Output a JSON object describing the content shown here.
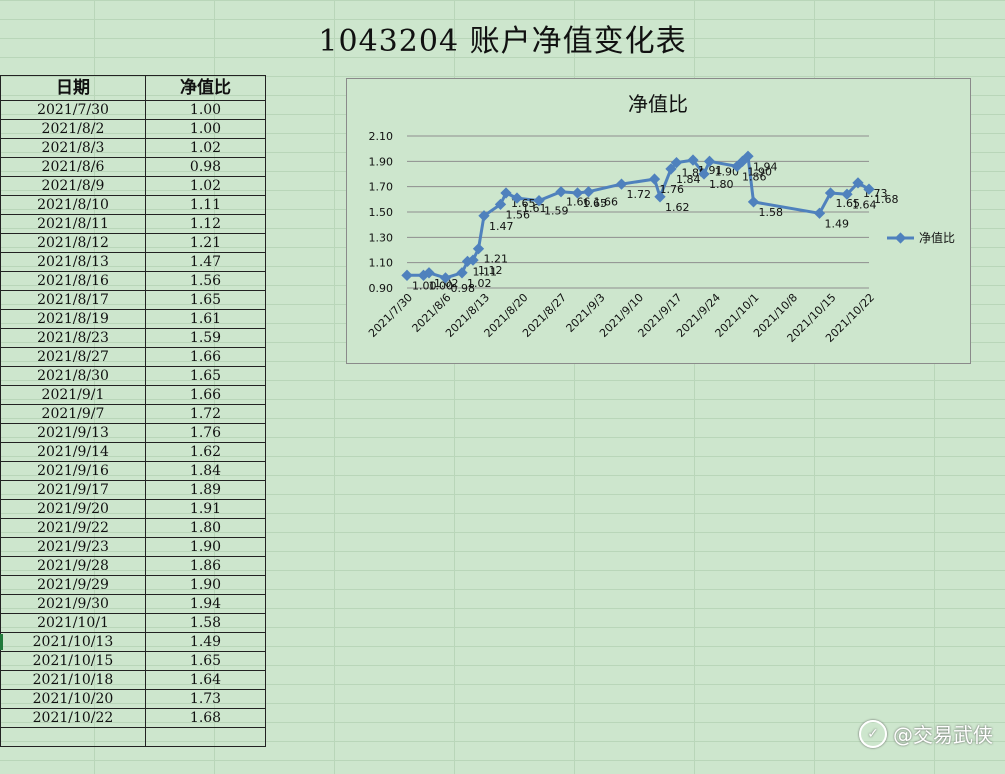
{
  "sheet": {
    "title": "1043204 账户净值变化表",
    "headers": [
      "日期",
      "净值比"
    ],
    "rows": [
      [
        "2021/7/30",
        "1.00"
      ],
      [
        "2021/8/2",
        "1.00"
      ],
      [
        "2021/8/3",
        "1.02"
      ],
      [
        "2021/8/6",
        "0.98"
      ],
      [
        "2021/8/9",
        "1.02"
      ],
      [
        "2021/8/10",
        "1.11"
      ],
      [
        "2021/8/11",
        "1.12"
      ],
      [
        "2021/8/12",
        "1.21"
      ],
      [
        "2021/8/13",
        "1.47"
      ],
      [
        "2021/8/16",
        "1.56"
      ],
      [
        "2021/8/17",
        "1.65"
      ],
      [
        "2021/8/19",
        "1.61"
      ],
      [
        "2021/8/23",
        "1.59"
      ],
      [
        "2021/8/27",
        "1.66"
      ],
      [
        "2021/8/30",
        "1.65"
      ],
      [
        "2021/9/1",
        "1.66"
      ],
      [
        "2021/9/7",
        "1.72"
      ],
      [
        "2021/9/13",
        "1.76"
      ],
      [
        "2021/9/14",
        "1.62"
      ],
      [
        "2021/9/16",
        "1.84"
      ],
      [
        "2021/9/17",
        "1.89"
      ],
      [
        "2021/9/20",
        "1.91"
      ],
      [
        "2021/9/22",
        "1.80"
      ],
      [
        "2021/9/23",
        "1.90"
      ],
      [
        "2021/9/28",
        "1.86"
      ],
      [
        "2021/9/29",
        "1.90"
      ],
      [
        "2021/9/30",
        "1.94"
      ],
      [
        "2021/10/1",
        "1.58"
      ],
      [
        "2021/10/13",
        "1.49"
      ],
      [
        "2021/10/15",
        "1.65"
      ],
      [
        "2021/10/18",
        "1.64"
      ],
      [
        "2021/10/20",
        "1.73"
      ],
      [
        "2021/10/22",
        "1.68"
      ],
      [
        "",
        ""
      ]
    ]
  },
  "chart_data": {
    "type": "line",
    "title": "净值比",
    "legend": "净值比",
    "legend_position": "right",
    "xlabel": "",
    "ylabel": "",
    "ylim": [
      0.9,
      2.1
    ],
    "yticks": [
      "2.10",
      "1.90",
      "1.70",
      "1.50",
      "1.30",
      "1.10",
      "0.90"
    ],
    "xticks": [
      "2021/7/30",
      "2021/8/6",
      "2021/8/13",
      "2021/8/20",
      "2021/8/27",
      "2021/9/3",
      "2021/9/10",
      "2021/9/17",
      "2021/9/24",
      "2021/10/1",
      "2021/10/8",
      "2021/10/15",
      "2021/10/22"
    ],
    "grid": true,
    "series_color": "#4f81bd",
    "x": [
      "2021/7/30",
      "2021/8/2",
      "2021/8/3",
      "2021/8/6",
      "2021/8/9",
      "2021/8/10",
      "2021/8/11",
      "2021/8/12",
      "2021/8/13",
      "2021/8/16",
      "2021/8/17",
      "2021/8/19",
      "2021/8/23",
      "2021/8/27",
      "2021/8/30",
      "2021/9/1",
      "2021/9/7",
      "2021/9/13",
      "2021/9/14",
      "2021/9/16",
      "2021/9/17",
      "2021/9/20",
      "2021/9/22",
      "2021/9/23",
      "2021/9/28",
      "2021/9/29",
      "2021/9/30",
      "2021/10/1",
      "2021/10/13",
      "2021/10/15",
      "2021/10/18",
      "2021/10/20",
      "2021/10/22"
    ],
    "values": [
      1.0,
      1.0,
      1.02,
      0.98,
      1.02,
      1.11,
      1.12,
      1.21,
      1.47,
      1.56,
      1.65,
      1.61,
      1.59,
      1.66,
      1.65,
      1.66,
      1.72,
      1.76,
      1.62,
      1.84,
      1.89,
      1.91,
      1.8,
      1.9,
      1.86,
      1.9,
      1.94,
      1.58,
      1.49,
      1.65,
      1.64,
      1.73,
      1.68
    ]
  },
  "watermark": {
    "text": "@交易武侠",
    "icon": "share-logo-icon"
  }
}
